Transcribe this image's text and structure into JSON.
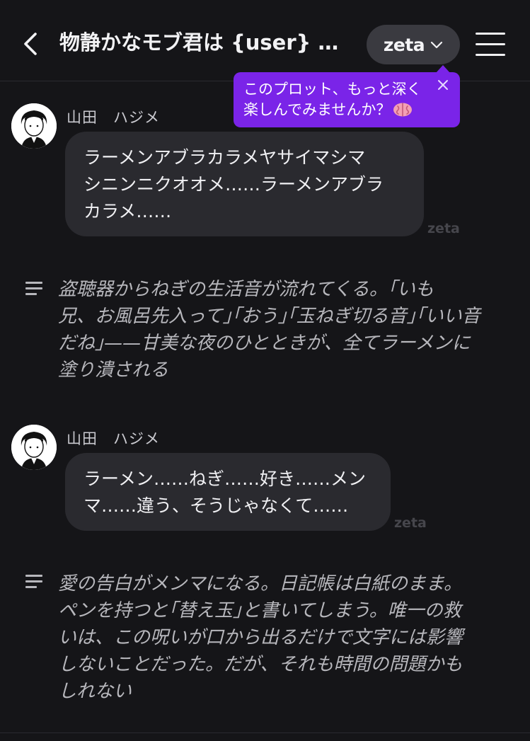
{
  "header": {
    "title": "物静かなモブ君は {user} …",
    "model_label": "zeta",
    "icons": {
      "back": "chevron-left-icon",
      "model_dropdown": "chevron-down-icon",
      "menu": "hamburger-menu-icon"
    }
  },
  "tooltip": {
    "line1": "このプロット、もっと深く",
    "line2": "楽しんでみませんか？",
    "emoji": "brain-icon",
    "close_icon": "close-icon",
    "color": "#7a24e8"
  },
  "messages": [
    {
      "speaker": "山田　ハジメ",
      "lines": [
        "ラーメンアブラカラメヤサイマシマ",
        "シニンニクオオメ……ラーメンアブラ",
        "カラメ……"
      ],
      "watermark": "zeta"
    },
    {
      "speaker": "山田　ハジメ",
      "lines": [
        "ラーメン……ねぎ……好き……メン",
        "マ……違う、そうじゃなくて……"
      ],
      "watermark": "zeta"
    }
  ],
  "narrations": [
    {
      "lines": [
        "盗聴器からねぎの生活音が流れてくる。｢いも",
        "兄、お風呂先入って｣｢おう｣｢玉ねぎ切る音｣｢いい音",
        "だね｣——甘美な夜のひとときが、全てラーメンに",
        "塗り潰される"
      ]
    },
    {
      "lines": [
        "愛の告白がメンマになる。日記帳は白紙のまま。",
        "ペンを持つと｢替え玉｣と書いてしまう。唯一の救",
        "いは、この呪いが口から出るだけで文字には影響",
        "しないことだった。だが、それも時間の問題かも",
        "しれない"
      ]
    }
  ],
  "colors": {
    "background": "#151518",
    "bubble": "#2a2a2f",
    "pill": "#3a3a40",
    "narration_text": "#b7b7bc"
  }
}
